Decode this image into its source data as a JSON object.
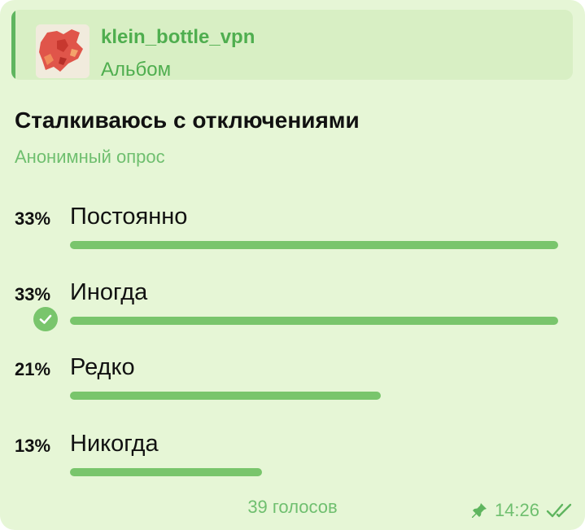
{
  "reply": {
    "channel": "klein_bottle_vpn",
    "label": "Альбом"
  },
  "poll": {
    "question": "Сталкиваюсь с отключениями",
    "type": "Анонимный опрос",
    "options": [
      {
        "percent_label": "33%",
        "label": "Постоянно",
        "share": 0.33
      },
      {
        "percent_label": "33%",
        "label": "Иногда",
        "share": 0.33,
        "chosen": true
      },
      {
        "percent_label": "21%",
        "label": "Редко",
        "share": 0.21
      },
      {
        "percent_label": "13%",
        "label": "Никогда",
        "share": 0.13
      }
    ],
    "votes": "39 голосов"
  },
  "message": {
    "time": "14:26",
    "pinned_icon": "pin-icon",
    "status_icon": "double-check-icon"
  },
  "colors": {
    "bubble": "#e6f6d6",
    "accent": "#79c56c",
    "accent_text": "#4fae4f"
  }
}
